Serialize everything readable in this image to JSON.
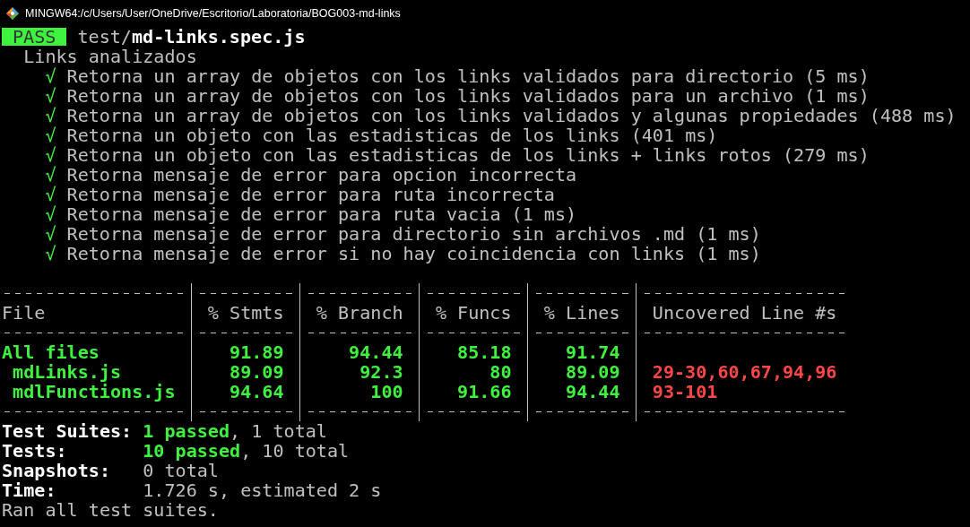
{
  "window": {
    "title": "MINGW64:/c/Users/User/OneDrive/Escritorio/Laboratoria/BOG003-md-links"
  },
  "result": {
    "passed": true,
    "badge": "PASS",
    "dir": "test/",
    "file": "md-links.spec.js"
  },
  "describe": "Links analizados",
  "tests": [
    {
      "passed": true,
      "mark": "√",
      "name": "Retorna un array de objetos con los links validados para directorio",
      "duration": "(5 ms)"
    },
    {
      "passed": true,
      "mark": "√",
      "name": "Retorna un array de objetos con los links validados para un archivo",
      "duration": "(1 ms)"
    },
    {
      "passed": true,
      "mark": "√",
      "name": "Retorna un array de objetos con los links validados y algunas propiedades",
      "duration": "(488 ms)"
    },
    {
      "passed": true,
      "mark": "√",
      "name": "Retorna un objeto con las estadisticas de los links",
      "duration": "(401 ms)"
    },
    {
      "passed": true,
      "mark": "√",
      "name": "Retorna un objeto con las estadisticas de los links + links rotos",
      "duration": "(279 ms)"
    },
    {
      "passed": true,
      "mark": "√",
      "name": "Retorna mensaje de error para opcion incorrecta"
    },
    {
      "passed": true,
      "mark": "√",
      "name": "Retorna mensaje de error para ruta incorrecta"
    },
    {
      "passed": true,
      "mark": "√",
      "name": "Retorna mensaje de error para ruta vacia",
      "duration": "(1 ms)"
    },
    {
      "passed": true,
      "mark": "√",
      "name": "Retorna mensaje de error para directorio sin archivos .md",
      "duration": "(1 ms)"
    },
    {
      "passed": true,
      "mark": "√",
      "name": "Retorna mensaje de error si no hay coincidencia con links",
      "duration": "(1 ms)"
    }
  ],
  "coverage_table": {
    "columns": [
      "File",
      "% Stmts",
      "% Branch",
      "% Funcs",
      "% Lines",
      "Uncovered Line #s"
    ],
    "rows": [
      {
        "file": "All files",
        "stmts": "91.89",
        "branch": "94.44",
        "funcs": "85.18",
        "lines": "91.74",
        "children": [
          {
            "file": "mdLinks.js",
            "stmts": "89.09",
            "branch": "92.3",
            "funcs": "80",
            "lines": "89.09",
            "uncovered": "29-30,60,67,94,96"
          },
          {
            "file": "mdlFunctions.js",
            "stmts": "94.64",
            "branch": "100",
            "funcs": "91.66",
            "lines": "94.44",
            "uncovered": "93-101"
          }
        ]
      }
    ]
  },
  "summary": [
    {
      "label": "Test Suites:",
      "passed": "1 passed",
      "rest": ", 1 total"
    },
    {
      "label": "Tests:",
      "passed": "10 passed",
      "rest": ", 10 total"
    },
    {
      "label": "Snapshots:",
      "rest": "0 total"
    },
    {
      "label": "Time:",
      "rest": "1.726 s, estimated 2 s"
    }
  ],
  "footer": "Ran all test suites."
}
